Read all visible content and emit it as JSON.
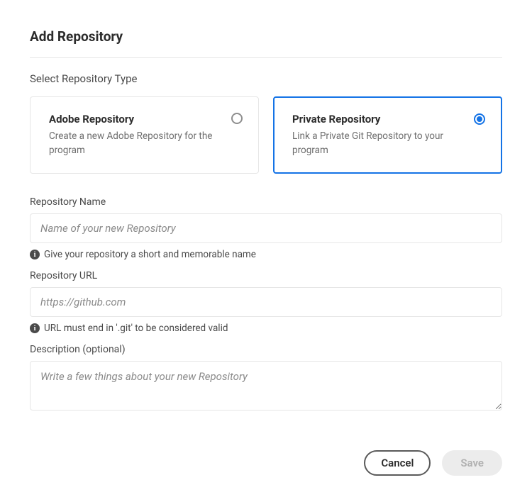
{
  "dialog": {
    "title": "Add Repository"
  },
  "section": {
    "select_type_label": "Select Repository Type"
  },
  "repo_types": {
    "adobe": {
      "title": "Adobe Repository",
      "description": "Create a new Adobe Repository for the program",
      "selected": false
    },
    "private": {
      "title": "Private Repository",
      "description": "Link a Private Git Repository to your program",
      "selected": true
    }
  },
  "fields": {
    "repo_name": {
      "label": "Repository Name",
      "placeholder": "Name of your new Repository",
      "value": "",
      "helper": "Give your repository a short and memorable name"
    },
    "repo_url": {
      "label": "Repository URL",
      "placeholder": "https://github.com",
      "value": "",
      "helper": "URL must end in '.git' to be considered valid"
    },
    "description": {
      "label": "Description (optional)",
      "placeholder": "Write a few things about your new Repository",
      "value": ""
    }
  },
  "buttons": {
    "cancel": "Cancel",
    "save": "Save"
  }
}
